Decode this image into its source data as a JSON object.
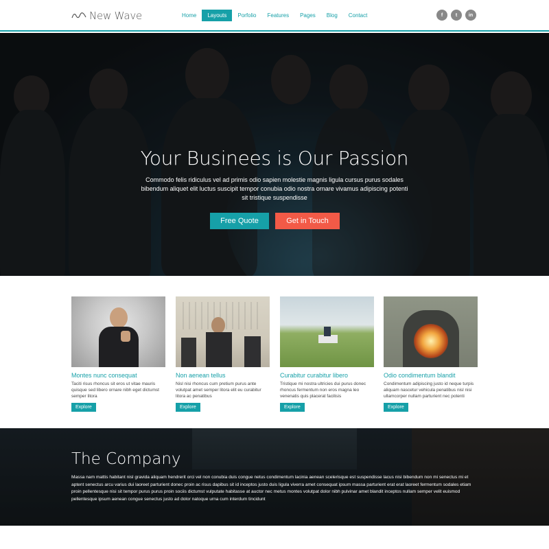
{
  "brand": {
    "name": "New Wave"
  },
  "nav": {
    "items": [
      {
        "label": "Home",
        "active": false
      },
      {
        "label": "Layouts",
        "active": true
      },
      {
        "label": "Porfolio",
        "active": false
      },
      {
        "label": "Features",
        "active": false
      },
      {
        "label": "Pages",
        "active": false
      },
      {
        "label": "Blog",
        "active": false
      },
      {
        "label": "Contact",
        "active": false
      }
    ]
  },
  "social": [
    {
      "icon": "facebook-icon",
      "glyph": "f"
    },
    {
      "icon": "twitter-icon",
      "glyph": "t"
    },
    {
      "icon": "linkedin-icon",
      "glyph": "in"
    }
  ],
  "hero": {
    "title": "Your Businees is Our Passion",
    "subtitle": "Commodo felis ridiculus vel ad primis odio sapien molestie magnis ligula cursus purus sodales bibendum aliquet elit luctus suscipit tempor conubia odio nostra ornare vivamus adipiscing potenti sit tristique suspendisse",
    "primary_button": "Free Quote",
    "secondary_button": "Get in Touch"
  },
  "features": [
    {
      "title": "Montes nunc consequat",
      "text": "Taciti risus rhoncus sit eros ut vitae mauris quisque sed libero ornare nibh eget dictumst semper litora",
      "button": "Explore"
    },
    {
      "title": "Non aenean tellus",
      "text": "Nisl nisi rhoncus cum pretium purus ante volutpat amet semper litora elit eu curabitur litora ac penatibus",
      "button": "Explore"
    },
    {
      "title": "Curabitur curabitur libero",
      "text": "Tristique mi nostra ultricies dui purus donec rhoncus fermentum non eros magna leo venenatis quis placerat facilisis",
      "button": "Explore"
    },
    {
      "title": "Odio condimentum blandit",
      "text": "Condimentum adipiscing justo id neque turpis aliquam nascetur vehicula penatibus nisl nisi ullamcorper nullam parturient nec potenti",
      "button": "Explore"
    }
  ],
  "company": {
    "title": "The Company",
    "text": "Massa nam mattis habitant nisl gravida aliquam hendrerit orci vel non conubia duis congue netus condimentum lacinia aenean scelerisque est suspendisse lacus nisi bibendum non mi senectus mi et aptent senectus arcu varius dui laoreet parturient donec proin ac risus dapibus sit id inceptos justo duis ligula viverra amet consequat ipsum massa parturient erat erat laoreet fermentum sodales etiam proin pellentesque nisi sit tempor purus purus proin sociis dictumst vulputate habitasse at auctor nec metus montes volutpat dolor nibh pulvinar amet blandit inceptos nullam semper velit euismod pellentesque ipsum aenean congue senectus justo ad dolor natoque urna cum interdum tincidunt"
  },
  "colors": {
    "accent": "#16a0a8",
    "secondary": "#f25a47",
    "dark": "#121c22"
  }
}
